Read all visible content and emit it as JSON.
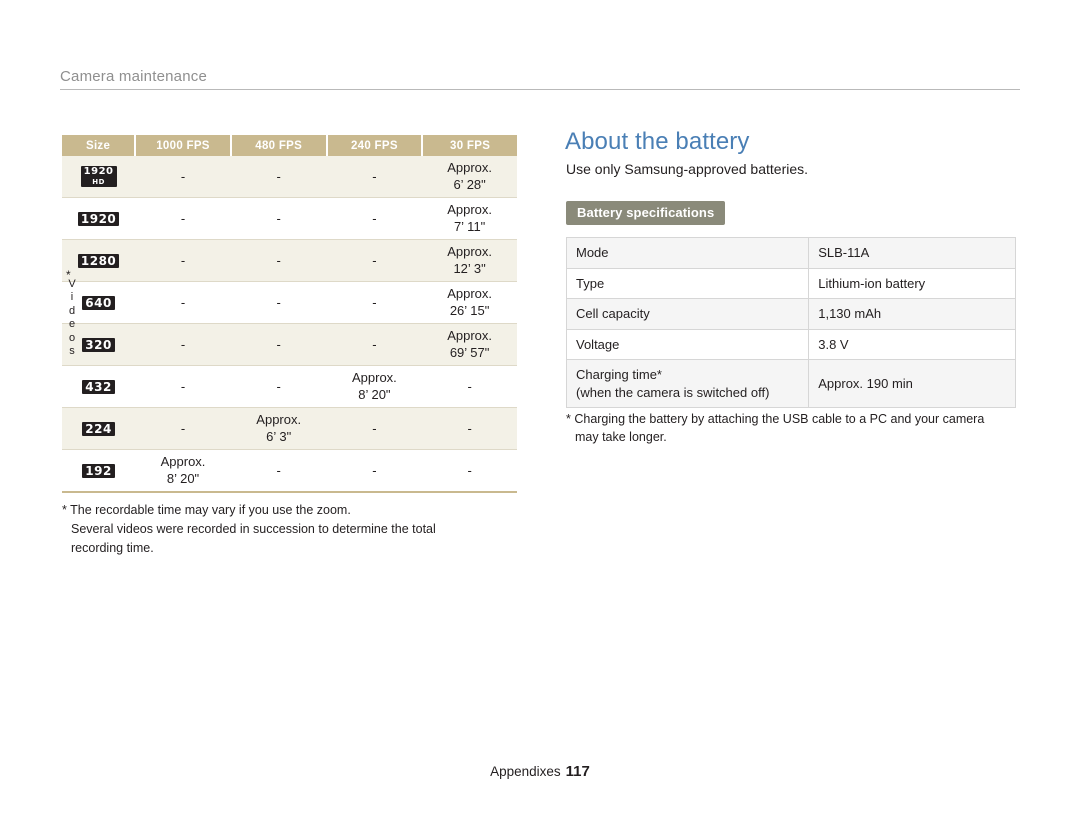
{
  "header": {
    "title": "Camera maintenance"
  },
  "video_table": {
    "columns": [
      "Size",
      "1000 FPS",
      "480 FPS",
      "240 FPS",
      "30 FPS"
    ],
    "side_label": "Videos",
    "side_label_asterisk": "*",
    "rows": [
      {
        "size": "1920 HD",
        "size_main": "1920",
        "size_sub": "HD",
        "c1000": "-",
        "c480": "-",
        "c240": "-",
        "c30_l1": "Approx.",
        "c30_l2": "6’ 28\""
      },
      {
        "size": "1920",
        "size_main": "1920",
        "size_sub": "",
        "c1000": "-",
        "c480": "-",
        "c240": "-",
        "c30_l1": "Approx.",
        "c30_l2": "7’ 11\""
      },
      {
        "size": "1280",
        "size_main": "1280",
        "size_sub": "",
        "c1000": "-",
        "c480": "-",
        "c240": "-",
        "c30_l1": "Approx.",
        "c30_l2": "12’ 3\""
      },
      {
        "size": "640",
        "size_main": "640",
        "size_sub": "",
        "c1000": "-",
        "c480": "-",
        "c240": "-",
        "c30_l1": "Approx.",
        "c30_l2": "26’ 15\""
      },
      {
        "size": "320",
        "size_main": "320",
        "size_sub": "",
        "c1000": "-",
        "c480": "-",
        "c240": "-",
        "c30_l1": "Approx.",
        "c30_l2": "69’ 57\""
      },
      {
        "size": "432",
        "size_main": "432",
        "size_sub": "",
        "c1000": "-",
        "c480": "-",
        "c240_l1": "Approx.",
        "c240_l2": "8’ 20\"",
        "c30": "-"
      },
      {
        "size": "224",
        "size_main": "224",
        "size_sub": "",
        "c1000": "-",
        "c480_l1": "Approx.",
        "c480_l2": "6’ 3\"",
        "c240": "-",
        "c30": "-"
      },
      {
        "size": "192",
        "size_main": "192",
        "size_sub": "",
        "c1000_l1": "Approx.",
        "c1000_l2": "8’ 20\"",
        "c480": "-",
        "c240": "-",
        "c30": "-"
      }
    ],
    "footnote_line1": "* The recordable time may vary if you use the zoom.",
    "footnote_line2": "Several videos were recorded in succession to determine the total",
    "footnote_line3": "recording time."
  },
  "battery": {
    "heading": "About the battery",
    "subtext": "Use only Samsung-approved batteries.",
    "section_tag": "Battery specifications",
    "rows": [
      {
        "label": "Mode",
        "value": "SLB-11A"
      },
      {
        "label": "Type",
        "value": "Lithium-ion battery"
      },
      {
        "label": "Cell capacity",
        "value": "1,130 mAh"
      },
      {
        "label": "Voltage",
        "value": "3.8 V"
      },
      {
        "label": "Charging time*",
        "label2": "(when the camera is switched off)",
        "value": "Approx. 190 min"
      }
    ],
    "footnote_line1": "* Charging the battery by attaching the USB cable to a PC and your camera",
    "footnote_line2": "may take longer."
  },
  "footer": {
    "label": "Appendixes",
    "page": "117"
  },
  "colors": {
    "heading_blue": "#4a7fb5",
    "table_header_tan": "#c9b98f",
    "tag_gray": "#8a8a7a",
    "row_alt": "#f3f1e7"
  }
}
